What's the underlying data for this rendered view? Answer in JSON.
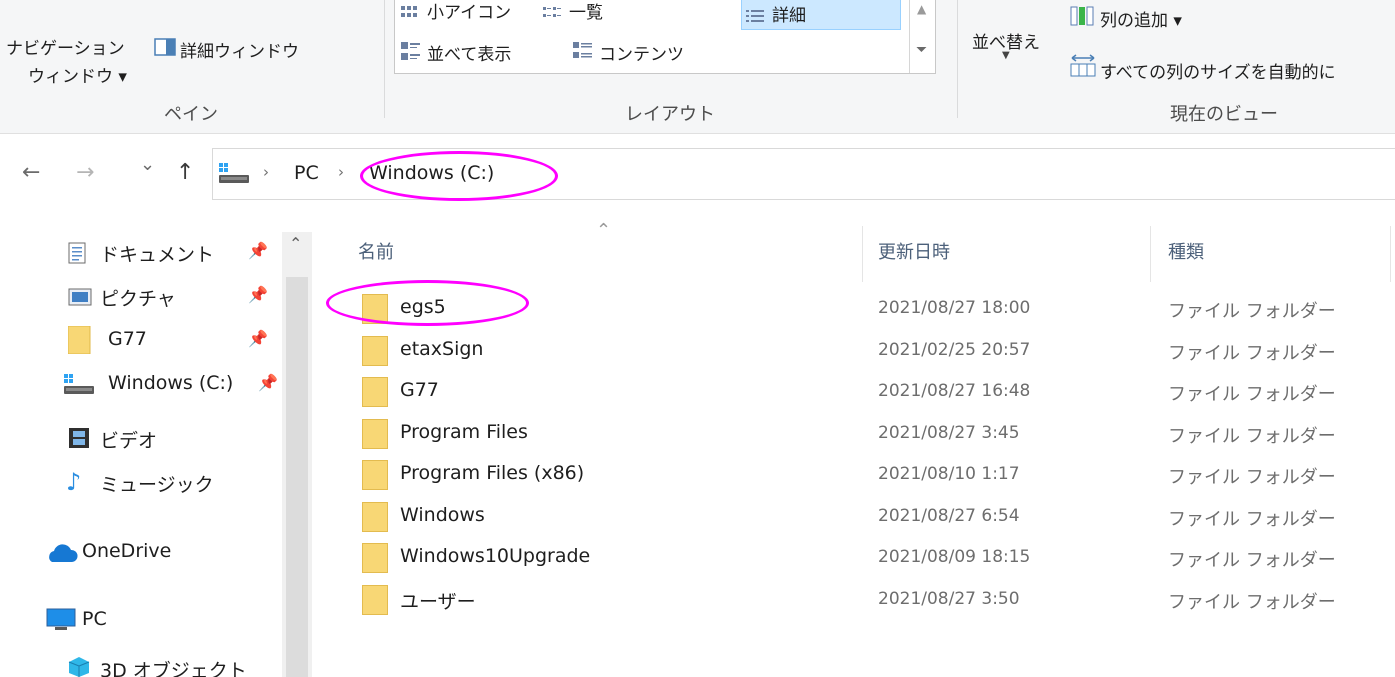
{
  "ribbon": {
    "pane": {
      "nav_pane_line1": "ナビゲーション",
      "nav_pane_line2": "ウィンドウ ▾",
      "details_pane": "詳細ウィンドウ",
      "group_label": "ペイン"
    },
    "layout": {
      "small_icons": "小アイコン",
      "list": "一覧",
      "details": "詳細",
      "tiles": "並べて表示",
      "content": "コンテンツ",
      "group_label": "レイアウト"
    },
    "current_view": {
      "sort_by": "並べ替え",
      "add_columns": "列の追加 ▾",
      "size_all_columns": "すべての列のサイズを自動的に",
      "group_label": "現在のビュー"
    }
  },
  "address_bar": {
    "back": "←",
    "forward": "→",
    "recent": "⌄",
    "up": "↑",
    "crumbs": [
      "PC",
      "Windows (C:)"
    ]
  },
  "nav_pane": {
    "items": [
      {
        "label": "ドキュメント",
        "icon": "document-icon",
        "pinned": true
      },
      {
        "label": "ピクチャ",
        "icon": "pictures-icon",
        "pinned": true
      },
      {
        "label": "G77",
        "icon": "folder-icon",
        "pinned": true
      },
      {
        "label": "Windows (C:)",
        "icon": "drive-icon",
        "pinned": true
      },
      {
        "label": "ビデオ",
        "icon": "video-icon",
        "pinned": false
      },
      {
        "label": "ミュージック",
        "icon": "music-icon",
        "pinned": false
      },
      {
        "label": "OneDrive",
        "icon": "cloud-icon",
        "pinned": false
      },
      {
        "label": "PC",
        "icon": "pc-icon",
        "pinned": false
      },
      {
        "label": "3D オブジェクト",
        "icon": "3d-objects-icon",
        "pinned": false
      }
    ]
  },
  "file_list": {
    "columns": {
      "name": "名前",
      "modified": "更新日時",
      "type": "種類"
    },
    "rows": [
      {
        "name": "egs5",
        "modified": "2021/08/27 18:00",
        "type": "ファイル フォルダー"
      },
      {
        "name": "etaxSign",
        "modified": "2021/02/25 20:57",
        "type": "ファイル フォルダー"
      },
      {
        "name": "G77",
        "modified": "2021/08/27 16:48",
        "type": "ファイル フォルダー"
      },
      {
        "name": "Program Files",
        "modified": "2021/08/27 3:45",
        "type": "ファイル フォルダー"
      },
      {
        "name": "Program Files (x86)",
        "modified": "2021/08/10 1:17",
        "type": "ファイル フォルダー"
      },
      {
        "name": "Windows",
        "modified": "2021/08/27 6:54",
        "type": "ファイル フォルダー"
      },
      {
        "name": "Windows10Upgrade",
        "modified": "2021/08/09 18:15",
        "type": "ファイル フォルダー"
      },
      {
        "name": "ユーザー",
        "modified": "2021/08/27 3:50",
        "type": "ファイル フォルダー"
      }
    ]
  },
  "colors": {
    "annotation": "#ff00ff",
    "folder": "#f8d775",
    "selection": "#cce8ff"
  }
}
